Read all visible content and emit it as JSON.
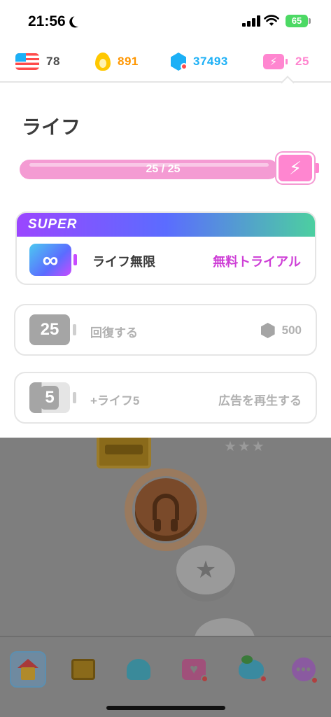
{
  "status_bar": {
    "time": "21:56",
    "battery": "65"
  },
  "stats": {
    "language_count": "78",
    "streak": "891",
    "gems": "37493",
    "energy": "25"
  },
  "panel": {
    "title": "ライフ",
    "progress_text": "25 / 25",
    "progress_fraction": 1.0,
    "super": {
      "badge": "SUPER",
      "feature_label": "ライフ無限",
      "action_label": "無料トライアル"
    },
    "refill": {
      "icon_value": "25",
      "label": "回復する",
      "cost": "500"
    },
    "ad": {
      "icon_value": "5",
      "label": "+ライフ5",
      "action_label": "広告を再生する"
    }
  },
  "colors": {
    "energy_pink": "#ff86d0",
    "super_purple": "#ce3fd6",
    "gem_blue": "#1cb0f6",
    "streak_orange": "#ffc800"
  },
  "icons": {
    "language": "us-flag-icon",
    "streak": "flame-icon",
    "gems": "gem-icon",
    "energy": "battery-bolt-icon",
    "nav": [
      "home-icon",
      "chest-icon",
      "shell-icon",
      "heart-icon",
      "bird-icon",
      "more-icon"
    ]
  }
}
